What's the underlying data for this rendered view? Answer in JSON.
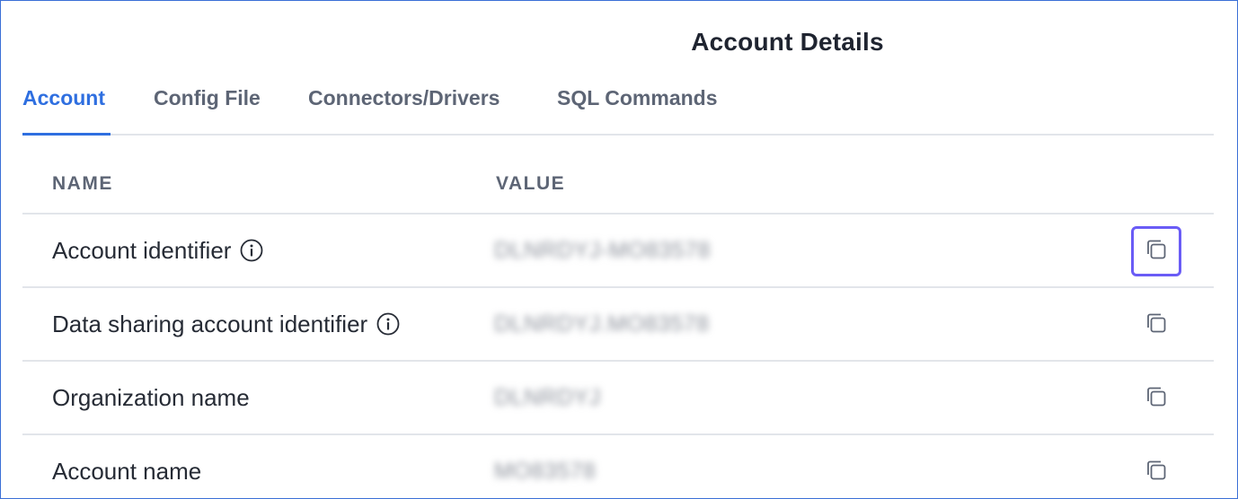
{
  "page": {
    "title": "Account Details"
  },
  "tabs": [
    {
      "label": "Account",
      "active": true
    },
    {
      "label": "Config File",
      "active": false
    },
    {
      "label": "Connectors/Drivers",
      "active": false
    },
    {
      "label": "SQL Commands",
      "active": false
    }
  ],
  "table": {
    "headers": {
      "name": "NAME",
      "value": "VALUE"
    },
    "rows": [
      {
        "name": "Account identifier",
        "value": "DLNRDYJ-MO83578",
        "has_info": true,
        "copy_focused": true
      },
      {
        "name": "Data sharing account identifier",
        "value": "DLNRDYJ.MO83578",
        "has_info": true,
        "copy_focused": false
      },
      {
        "name": "Organization name",
        "value": "DLNRDYJ",
        "has_info": false,
        "copy_focused": false
      },
      {
        "name": "Account name",
        "value": "MO83578",
        "has_info": false,
        "copy_focused": false
      }
    ]
  },
  "icons": {
    "info": "info-circle-icon",
    "copy": "copy-icon"
  },
  "colors": {
    "accent": "#2f6fe0",
    "focus_ring": "#6a5cf6",
    "border": "#3b6fd6"
  }
}
